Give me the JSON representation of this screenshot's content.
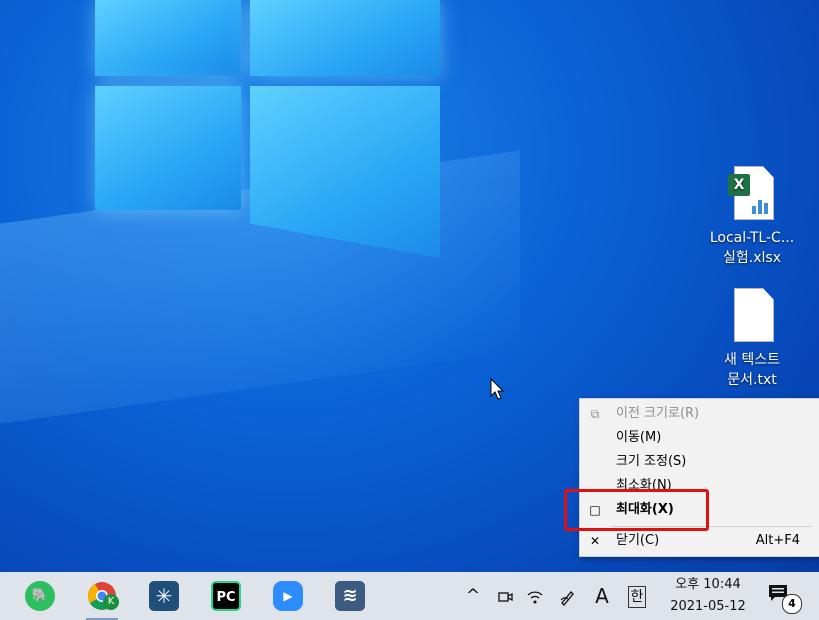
{
  "desktop": {
    "icons": [
      {
        "label_line1": "Local-TL-C...",
        "label_line2": "실험.xlsx",
        "icon": "excel-file-icon",
        "badge": "X"
      },
      {
        "label_line1": "새 텍스트",
        "label_line2": "문서.txt",
        "icon": "text-file-icon"
      }
    ]
  },
  "context_menu": {
    "items": [
      {
        "label": "이전 크기로",
        "mnemonic": "(R)",
        "icon": "restore-icon",
        "enabled": false
      },
      {
        "label": "이동",
        "mnemonic": "(M)",
        "icon": "",
        "enabled": true
      },
      {
        "label": "크기 조정",
        "mnemonic": "(S)",
        "icon": "",
        "enabled": true
      },
      {
        "label": "최소화",
        "mnemonic": "(N)",
        "icon": "",
        "enabled": true
      },
      {
        "label": "최대화",
        "mnemonic": "(X)",
        "icon": "maximize-icon",
        "enabled": true,
        "bold": true
      },
      {
        "label": "닫기",
        "mnemonic": "(C)",
        "icon": "close-icon",
        "shortcut": "Alt+F4",
        "enabled": true
      }
    ],
    "highlight_color": "#e11010"
  },
  "taskbar": {
    "apps": [
      {
        "name": "evernote-icon",
        "glyph": "E",
        "color": "#2dbe60"
      },
      {
        "name": "chrome-icon",
        "glyph": "K",
        "color": "#1a8f3c"
      },
      {
        "name": "app-icon",
        "glyph": "✳",
        "color": "#1f4e79"
      },
      {
        "name": "pycharm-icon",
        "glyph": "PC",
        "color": "#000000"
      },
      {
        "name": "zoom-icon",
        "glyph": "▶",
        "color": "#2d8cff"
      },
      {
        "name": "mysql-workbench-icon",
        "glyph": "≋",
        "color": "#3d5a80"
      }
    ],
    "tray": {
      "chevron": "^",
      "ime_mode": "A",
      "ime_lang": "한",
      "time": "오후 10:44",
      "date": "2021-05-12",
      "notification_count": "4"
    }
  }
}
